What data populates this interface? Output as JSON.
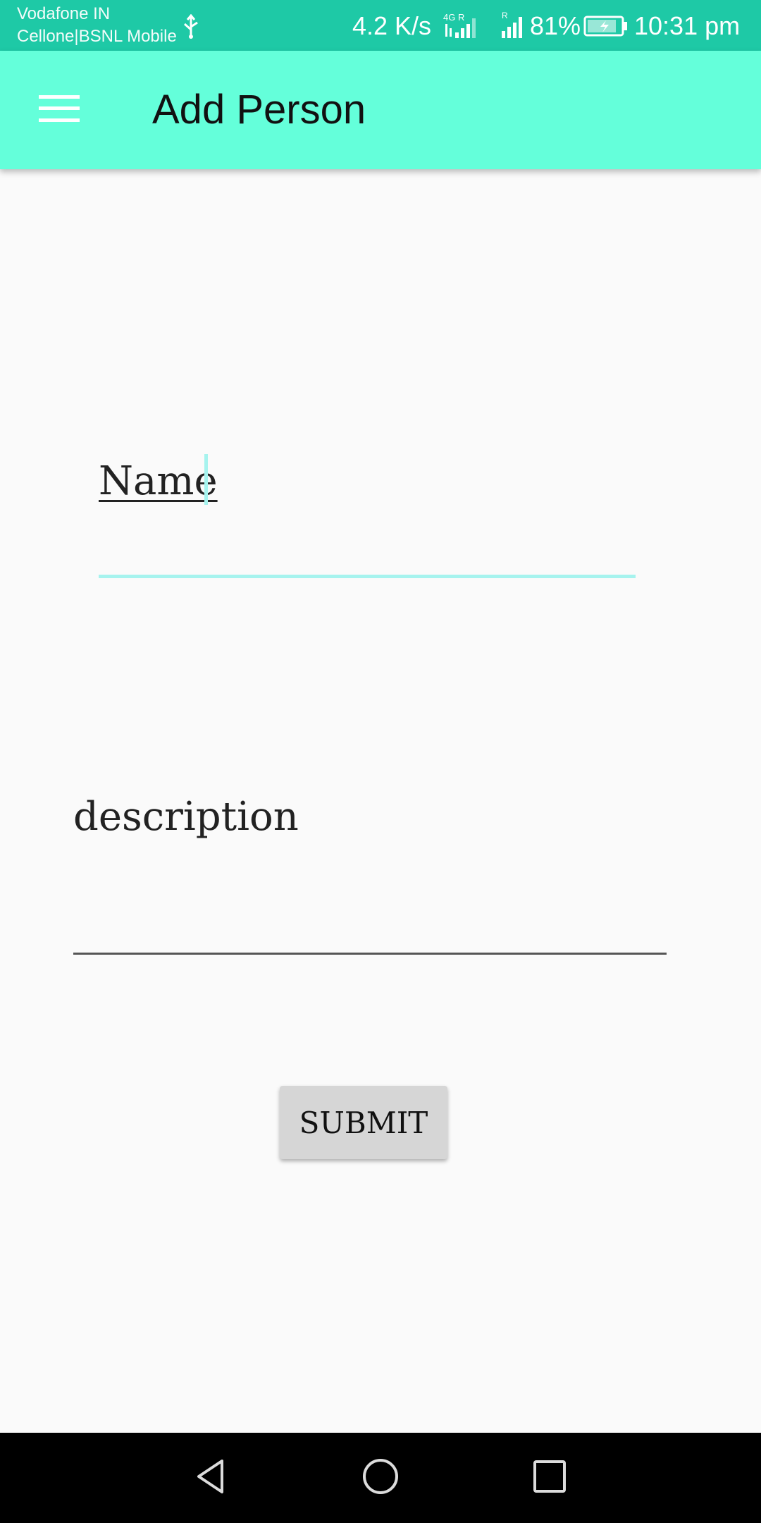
{
  "status_bar": {
    "carrier_1": "Vodafone IN",
    "carrier_2": "Cellone|BSNL Mobile",
    "usb_icon": "usb-icon",
    "network_speed": "4.2 K/s",
    "network_type_icon": "4g-signal-icon",
    "roaming_signal_icon": "roaming-signal-icon",
    "battery_percent": "81%",
    "battery_icon": "battery-charging-icon",
    "time": "10:31 pm",
    "color": "#1ec9a6"
  },
  "app_bar": {
    "menu_icon": "hamburger-menu-icon",
    "title": "Add Person",
    "color": "#64ffda"
  },
  "form": {
    "name_field": {
      "value": "Name",
      "focused": true,
      "accent_color": "#a6f3ee"
    },
    "description_field": {
      "placeholder": "description"
    },
    "submit_label": "SUBMIT"
  },
  "nav_bar": {
    "back_icon": "back-triangle-icon",
    "home_icon": "home-circle-icon",
    "recents_icon": "recents-square-icon"
  }
}
